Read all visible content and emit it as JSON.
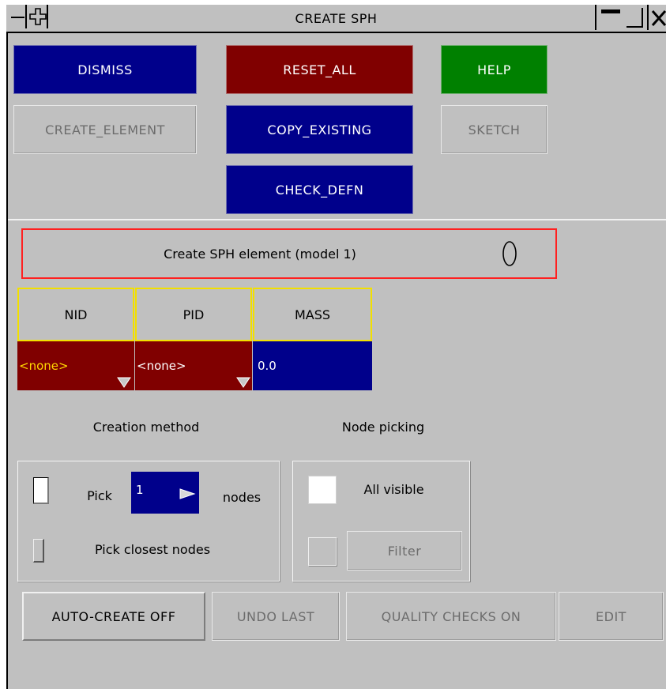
{
  "window": {
    "title": "CREATE SPH",
    "menu_icon": "minus-icon",
    "move_icon": "plus-icon",
    "minimize_icon": "minimize-icon",
    "maximize_icon": "maximize-icon",
    "close_icon": "close-icon"
  },
  "toolbar": {
    "dismiss": "DISMISS",
    "reset_all": "RESET_ALL",
    "help": "HELP",
    "create_element": "CREATE_ELEMENT",
    "copy_existing": "COPY_EXISTING",
    "sketch": "SKETCH",
    "check_defn": "CHECK_DEFN"
  },
  "status": {
    "message": "Create SPH element (model 1)",
    "indicator_icon": "zero-ring-icon"
  },
  "fields": {
    "headers": [
      "NID",
      "PID",
      "MASS"
    ],
    "nid_value": "<none>",
    "pid_value": "<none>",
    "mass_value": "0.0"
  },
  "creation": {
    "section_label": "Creation method",
    "pick_label": "Pick",
    "pick_count": "1",
    "nodes_label": "nodes",
    "pick_closest_label": "Pick closest nodes"
  },
  "node_picking": {
    "section_label": "Node picking",
    "all_visible_label": "All visible",
    "filter_label": "Filter"
  },
  "bottom_buttons": {
    "auto_create": "AUTO-CREATE OFF",
    "undo_last": "UNDO LAST",
    "quality_checks": "QUALITY CHECKS ON",
    "edit": "EDIT"
  },
  "colors": {
    "panel": "#c0c0c0",
    "blue": "#00008b",
    "red": "#800000",
    "green": "#008000",
    "none_text": "#ffd700",
    "status_border": "#ff2020",
    "header_border": "#f2e000"
  }
}
